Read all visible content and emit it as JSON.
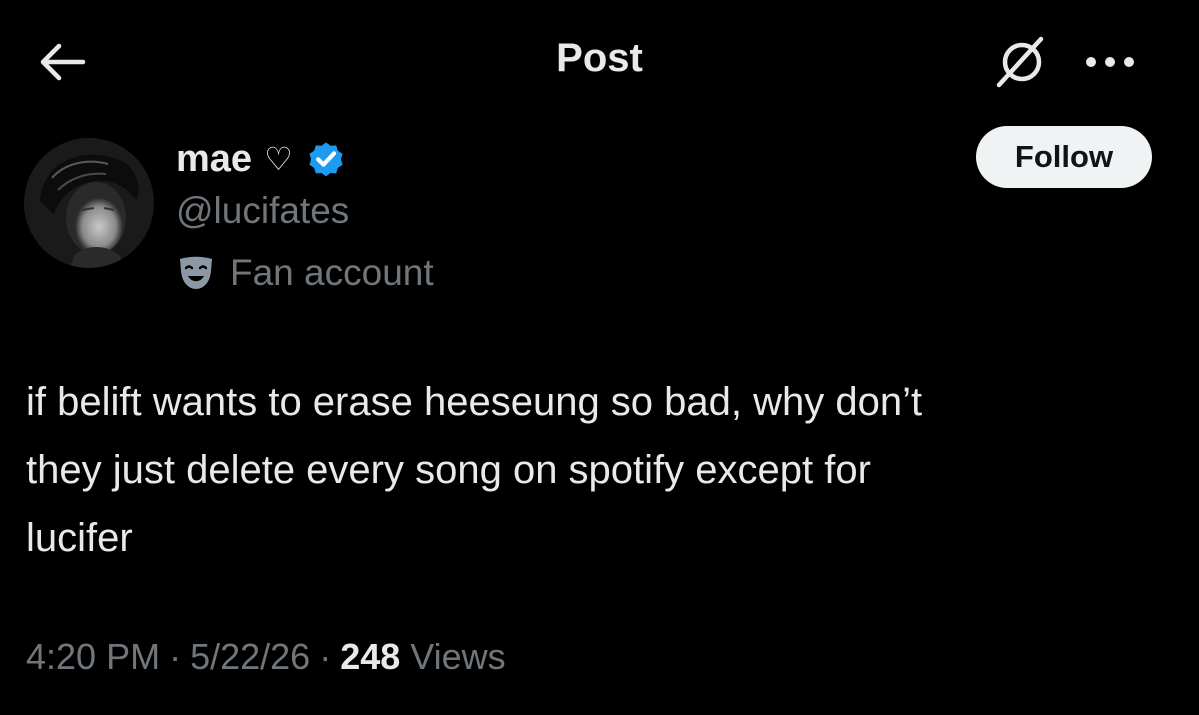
{
  "header": {
    "title": "Post",
    "back_icon": "arrow-left-icon",
    "grok_icon": "grok-slash-circle-icon",
    "more_icon": "more-horizontal-icon"
  },
  "author": {
    "display_name": "mae",
    "name_symbol": "♡",
    "handle": "@lucifates",
    "verified": true,
    "verified_color": "#1d9bf0",
    "affiliation_label": "Fan account",
    "affiliation_icon": "theater-mask-icon"
  },
  "follow_button": {
    "label": "Follow"
  },
  "post": {
    "text": "if belift wants to erase heeseung so bad, why don’t\nthey just delete every song on spotify except for\nlucifer"
  },
  "meta": {
    "time": "4:20 PM",
    "separator": "·",
    "date": "5/22/26",
    "views_count": "248",
    "views_label": "Views"
  },
  "colors": {
    "background": "#000000",
    "text_primary": "#e7e9ea",
    "text_secondary": "#71767b",
    "button_bg": "#eff3f4",
    "verified": "#1d9bf0"
  }
}
